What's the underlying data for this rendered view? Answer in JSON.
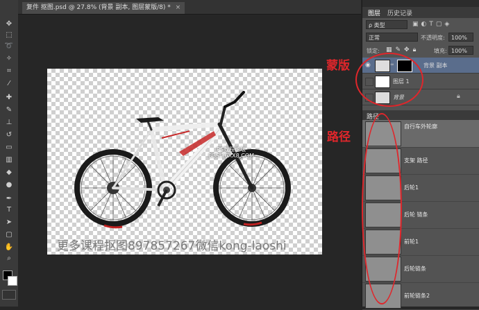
{
  "document": {
    "tab_title": "复件 抠图.psd @ 27.8% (背景 副本, 图层蒙版/8) *",
    "close_glyph": "×"
  },
  "toolbar": [
    "move",
    "marquee",
    "lasso",
    "magic-wand",
    "crop",
    "eyedropper",
    "healing",
    "brush",
    "stamp",
    "history-brush",
    "eraser",
    "gradient",
    "blur",
    "dodge",
    "pen",
    "type",
    "path-select",
    "shape",
    "hand",
    "zoom"
  ],
  "canvas": {
    "watermark": "更多课程抠图897857267微信kong-laoshi",
    "center_watermark_line1": "PS教程论坛",
    "center_watermark_line2": "BBS.16XX8.COM"
  },
  "annotations": {
    "mask": "蒙版",
    "paths": "路径"
  },
  "layers_panel": {
    "tabs": [
      "图层",
      "历史记录"
    ],
    "filter_label": "ρ 类型",
    "blend_mode": "正常",
    "opacity_label": "不透明度:",
    "opacity_value": "100%",
    "lock_label": "锁定:",
    "fill_label": "填充:",
    "fill_value": "100%",
    "layers": [
      {
        "name": "背景 副本",
        "selected": true
      },
      {
        "name": "图层 1",
        "selected": false
      },
      {
        "name": "背景",
        "selected": false
      }
    ]
  },
  "paths_panel": {
    "title": "路径",
    "paths": [
      {
        "name": "自行车外轮廓"
      },
      {
        "name": "支架 路径"
      },
      {
        "name": "后轮1"
      },
      {
        "name": "后轮 链条"
      },
      {
        "name": "前轮1"
      },
      {
        "name": "后轮链条"
      },
      {
        "name": "前轮链条2"
      }
    ]
  },
  "colors": {
    "annotation": "#e0262b",
    "selected_layer": "#5a6d8c"
  }
}
